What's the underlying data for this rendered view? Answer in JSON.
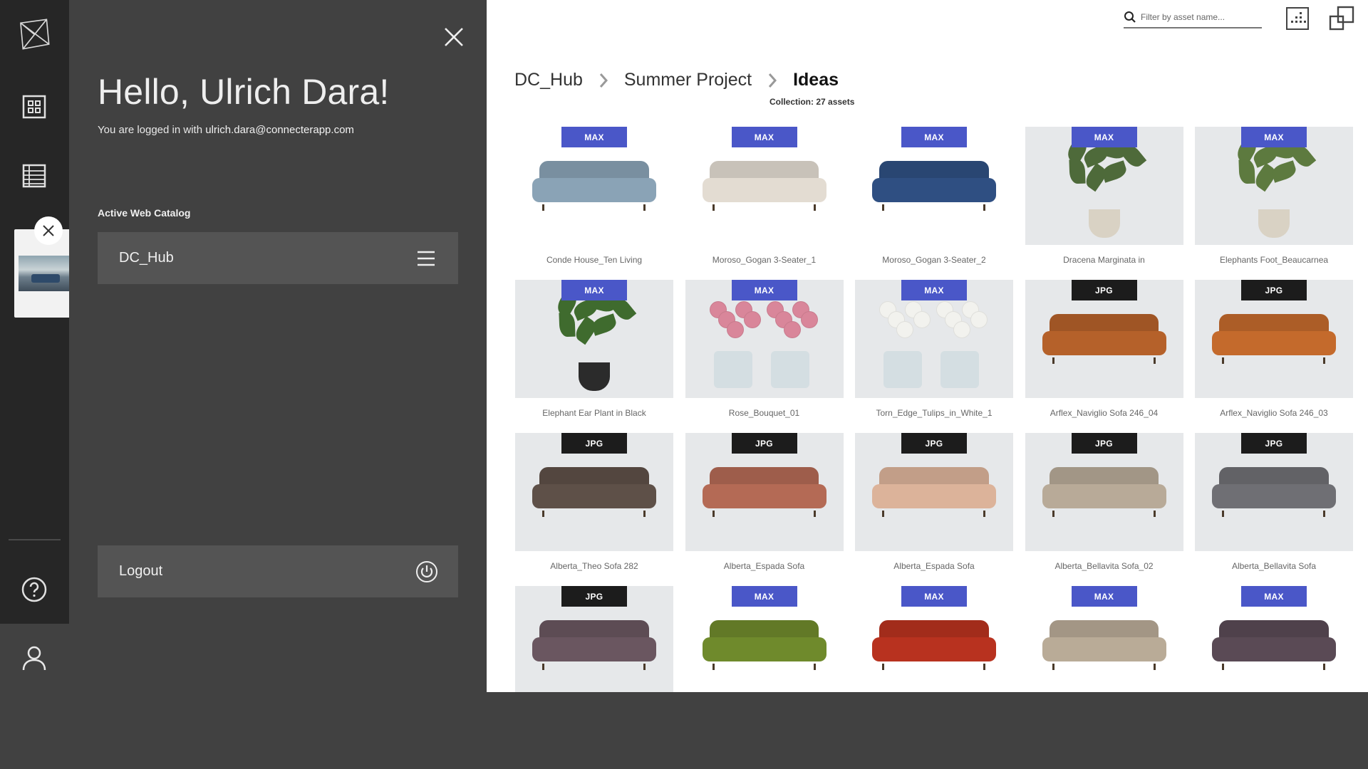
{
  "sidebar": {
    "icons": [
      "logo-icon",
      "catalog-grid-icon",
      "list-view-icon",
      "help-icon",
      "user-icon"
    ]
  },
  "panel": {
    "greeting": "Hello, Ulrich Dara!",
    "logged_in_prefix": "You are logged in with ",
    "email": "ulrich.dara@connecterapp.com",
    "active_catalog_label": "Active Web Catalog",
    "catalog_name": "DC_Hub",
    "logout_label": "Logout"
  },
  "header": {
    "search_placeholder": "Filter by asset name...",
    "breadcrumb": [
      "DC_Hub",
      "Summer Project",
      "Ideas"
    ],
    "collection_count": "Collection: 27 assets"
  },
  "colors": {
    "max_badge": "#4a57c8",
    "jpg_badge": "#1c1c1c",
    "rail": "#262626",
    "panel": "#414141"
  },
  "assets": [
    {
      "name": "Conde House_Ten Living",
      "badge": "MAX",
      "kind": "sofa",
      "color": "#8aa3b6"
    },
    {
      "name": "Moroso_Gogan 3-Seater_1",
      "badge": "MAX",
      "kind": "sofa",
      "color": "#e3dcd2"
    },
    {
      "name": "Moroso_Gogan 3-Seater_2",
      "badge": "MAX",
      "kind": "sofa",
      "color": "#2f4f82"
    },
    {
      "name": "Dracena Marginata in",
      "badge": "MAX",
      "kind": "plant",
      "color": "#4e6a3a"
    },
    {
      "name": "Elephants Foot_Beaucarnea",
      "badge": "MAX",
      "kind": "plant",
      "color": "#5d7a3f"
    },
    {
      "name": "Elephant Ear Plant in Black",
      "badge": "MAX",
      "kind": "plant",
      "color": "#3f6b2e"
    },
    {
      "name": "Rose_Bouquet_01",
      "badge": "MAX",
      "kind": "flowers",
      "color": "#d9869a"
    },
    {
      "name": "Torn_Edge_Tulips_in_White_1",
      "badge": "MAX",
      "kind": "flowers",
      "color": "#f2f2ee"
    },
    {
      "name": "Arflex_Naviglio Sofa 246_04",
      "badge": "JPG",
      "kind": "sofa",
      "color": "#b5612a"
    },
    {
      "name": "Arflex_Naviglio Sofa 246_03",
      "badge": "JPG",
      "kind": "sofa",
      "color": "#c46a2c"
    },
    {
      "name": "Alberta_Theo Sofa 282",
      "badge": "JPG",
      "kind": "sofa",
      "color": "#5e5048"
    },
    {
      "name": "Alberta_Espada Sofa",
      "badge": "JPG",
      "kind": "sofa",
      "color": "#b46a55"
    },
    {
      "name": "Alberta_Espada Sofa",
      "badge": "JPG",
      "kind": "sofa",
      "color": "#dcb39a"
    },
    {
      "name": "Alberta_Bellavita Sofa_02",
      "badge": "JPG",
      "kind": "sofa",
      "color": "#b8aa98"
    },
    {
      "name": "Alberta_Bellavita Sofa",
      "badge": "JPG",
      "kind": "sofa",
      "color": "#6f6f74"
    },
    {
      "name": "",
      "badge": "JPG",
      "kind": "sofa",
      "color": "#6a5660"
    },
    {
      "name": "",
      "badge": "MAX",
      "kind": "sofa",
      "color": "#6f8a2c"
    },
    {
      "name": "",
      "badge": "MAX",
      "kind": "sofa",
      "color": "#b8321f"
    },
    {
      "name": "",
      "badge": "MAX",
      "kind": "sofa",
      "color": "#b9ab97"
    },
    {
      "name": "",
      "badge": "MAX",
      "kind": "sofa",
      "color": "#5a4a55"
    }
  ]
}
